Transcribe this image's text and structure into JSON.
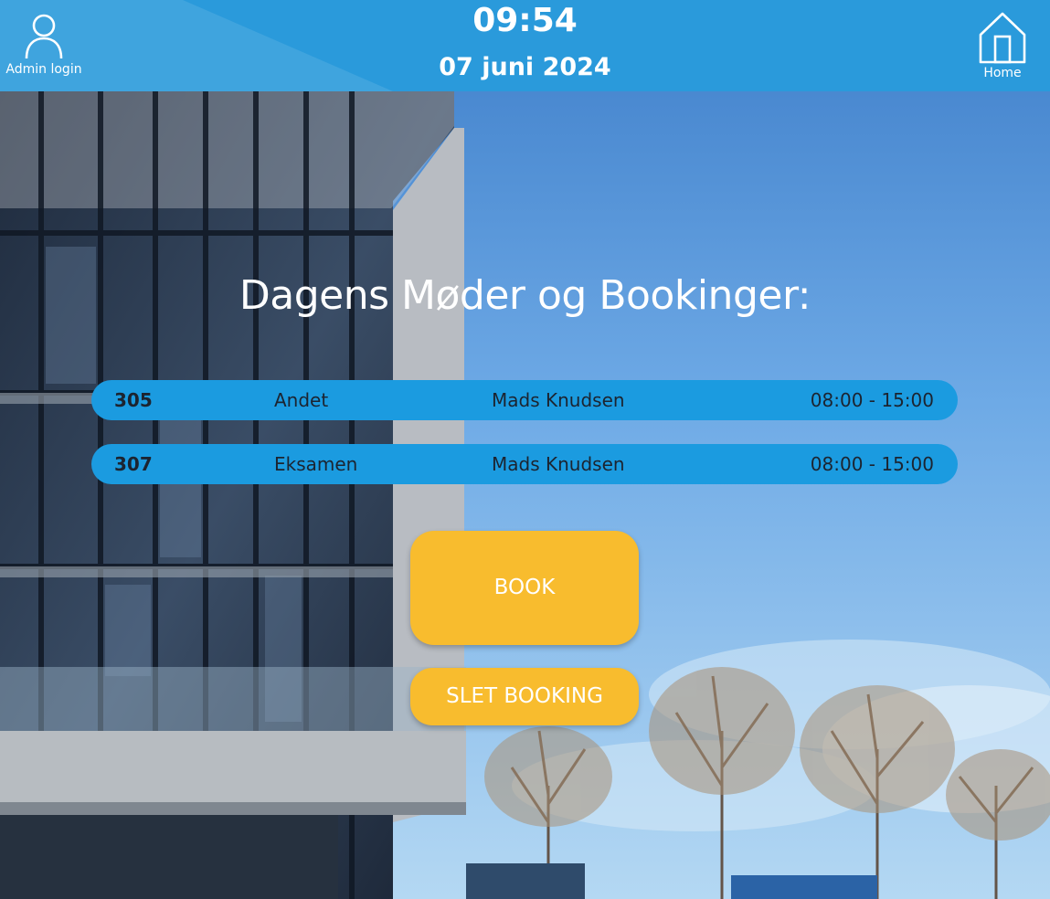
{
  "header": {
    "admin_label": "Admin login",
    "time": "09:54",
    "date": "07 juni 2024",
    "home_label": "Home",
    "icons": {
      "admin": "user-icon",
      "home": "home-icon"
    }
  },
  "main": {
    "heading": "Dagens Møder og Bookinger:",
    "bookings": [
      {
        "room": "305",
        "type": "Andet",
        "name": "Mads Knudsen",
        "time": "08:00 - 15:00"
      },
      {
        "room": "307",
        "type": "Eksamen",
        "name": "Mads Knudsen",
        "time": "08:00 - 15:00"
      }
    ],
    "book_label": "BOOK",
    "delete_label": "SLET BOOKING"
  },
  "colors": {
    "header_bg": "#2a9adb",
    "row_bg": "#1b9be0",
    "button_bg": "#f8bc2e",
    "text_light": "#ffffff",
    "text_dark": "#1c2430"
  }
}
